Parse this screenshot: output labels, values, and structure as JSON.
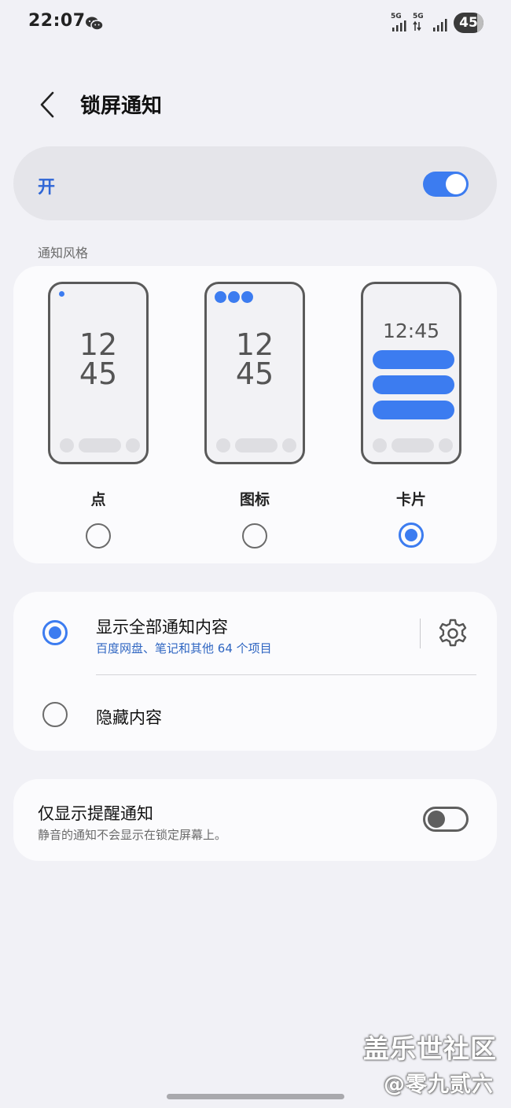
{
  "status_bar": {
    "time": "22:07",
    "app_icon": "wechat-icon",
    "sim1_label": "5G",
    "sim2_label": "5G",
    "battery": "45"
  },
  "header": {
    "back_icon": "chevron-left-icon",
    "title": "锁屏通知"
  },
  "master_switch": {
    "label": "开",
    "enabled": true
  },
  "notification_style": {
    "section_label": "通知风格",
    "options": [
      {
        "label": "点",
        "clock_hour": "12",
        "clock_minute": "45",
        "selected": false
      },
      {
        "label": "图标",
        "clock_hour": "12",
        "clock_minute": "45",
        "selected": false
      },
      {
        "label": "卡片",
        "clock": "12:45",
        "selected": true
      }
    ]
  },
  "content_options": {
    "show_all": {
      "title": "显示全部通知内容",
      "subtitle": "百度网盘、笔记和其他 64 个项目",
      "selected": true,
      "settings_icon": "gear-icon"
    },
    "hide": {
      "title": "隐藏内容",
      "selected": false
    }
  },
  "alerts_only": {
    "title": "仅显示提醒通知",
    "subtitle": "静音的通知不会显示在锁定屏幕上。",
    "enabled": false
  },
  "watermark": {
    "line1": "盖乐世社区",
    "line2": "@零九贰六"
  },
  "colors": {
    "accent": "#3c7cf0",
    "background": "#f1f1f6",
    "card": "#fbfbfd",
    "link_text": "#2f66c2"
  }
}
